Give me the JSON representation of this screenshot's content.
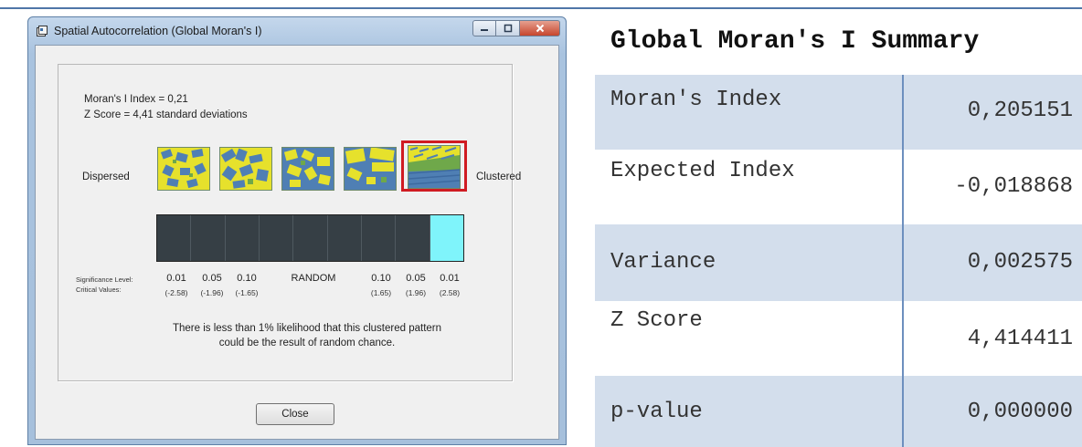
{
  "window": {
    "title": "Spatial Autocorrelation (Global Moran's I)",
    "icon": "app-icon",
    "controls": {
      "minimize": "minimize-icon",
      "maximize": "maximize-icon",
      "close": "close-icon"
    }
  },
  "stats": {
    "morans_index": "Moran's I Index = 0,21",
    "z_score": "Z Score = 4,41 standard deviations"
  },
  "pattern": {
    "left_label": "Dispersed",
    "right_label": "Clustered",
    "thumbnails": [
      "pattern-1",
      "pattern-2",
      "pattern-3",
      "pattern-4",
      "pattern-5"
    ],
    "selected_pattern": "pattern-5",
    "colors": {
      "yellow": "#e6e12c",
      "blue": "#4f7fb4",
      "green": "#6fa84a",
      "highlight": "#d01b22"
    }
  },
  "scale": {
    "cells": 9,
    "highlighted_cell": 9,
    "cell_color": "#363f45",
    "highlight_color": "#7ff4fb"
  },
  "significance": {
    "level_label": "Significance Level:",
    "critical_label": "Critical Values:",
    "levels": [
      "0.01",
      "0.05",
      "0.10",
      "RANDOM",
      "0.10",
      "0.05",
      "0.01"
    ],
    "critical_values": [
      "(-2.58)",
      "(-1.96)",
      "(-1.65)",
      "",
      "(1.65)",
      "(1.96)",
      "(2.58)"
    ]
  },
  "message": {
    "line1": "There is less than 1% likelihood that this clustered pattern",
    "line2": "could be the result of random chance."
  },
  "buttons": {
    "close_label": "Close"
  },
  "summary": {
    "title": "Global Moran's I Summary",
    "rows": [
      {
        "label": "Moran's Index",
        "value": "0,205151"
      },
      {
        "label": "Expected Index",
        "value": "-0,018868"
      },
      {
        "label": "Variance",
        "value": "0,002575"
      },
      {
        "label": "Z Score",
        "value": "4,414411"
      },
      {
        "label": "p-value",
        "value": "0,000000"
      }
    ],
    "colors": {
      "shade": "#d3deec",
      "divider": "#6d8fbe"
    }
  }
}
